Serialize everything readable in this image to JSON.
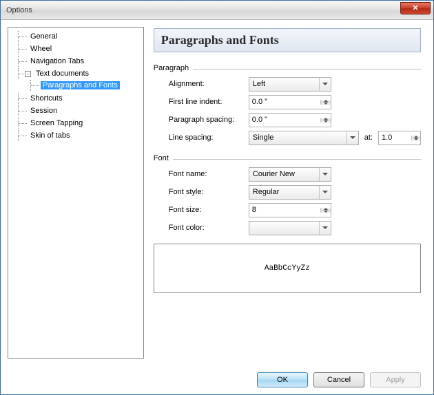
{
  "window": {
    "title": "Options"
  },
  "tree": {
    "items": [
      {
        "label": "General"
      },
      {
        "label": "Wheel"
      },
      {
        "label": "Navigation Tabs"
      },
      {
        "label": "Text documents",
        "expanded": true,
        "children": [
          {
            "label": "Paragraphs and Fonts",
            "selected": true
          }
        ]
      },
      {
        "label": "Shortcuts"
      },
      {
        "label": "Session"
      },
      {
        "label": "Screen Tapping"
      },
      {
        "label": "Skin of tabs"
      }
    ]
  },
  "page": {
    "title": "Paragraphs and Fonts"
  },
  "paragraph": {
    "legend": "Paragraph",
    "alignment_label": "Alignment:",
    "alignment_value": "Left",
    "first_line_label": "First line indent:",
    "first_line_value": "0.0 \"",
    "spacing_label": "Paragraph spacing:",
    "spacing_value": "0.0 \"",
    "line_spacing_label": "Line spacing:",
    "line_spacing_value": "Single",
    "at_label": "at:",
    "at_value": "1.0"
  },
  "font": {
    "legend": "Font",
    "name_label": "Font name:",
    "name_value": "Courier New",
    "style_label": "Font style:",
    "style_value": "Regular",
    "size_label": "Font size:",
    "size_value": "8",
    "color_label": "Font color:",
    "color_value": "#000000"
  },
  "preview": {
    "sample": "AaBbCcYyZz"
  },
  "buttons": {
    "ok": "OK",
    "cancel": "Cancel",
    "apply": "Apply"
  }
}
